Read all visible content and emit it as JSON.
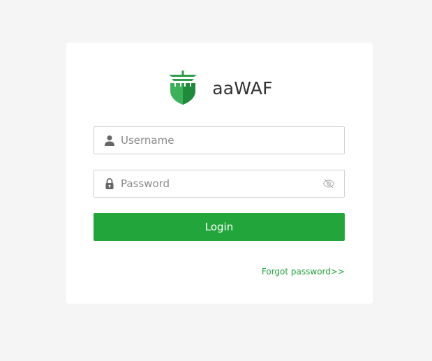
{
  "app": {
    "name": "aaWAF"
  },
  "login_form": {
    "username": {
      "placeholder": "Username",
      "value": "",
      "icon": "user-icon"
    },
    "password": {
      "placeholder": "Password",
      "value": "",
      "icon": "lock-icon",
      "toggle_icon": "eye-slash-icon"
    },
    "submit_label": "Login",
    "forgot_link": "Forgot password>>"
  },
  "colors": {
    "accent": "#22a63c",
    "logo_light": "#3cb15a",
    "logo_dark": "#1f8a3a",
    "background": "#f5f5f5",
    "card": "#ffffff",
    "icon_gray": "#666666"
  }
}
